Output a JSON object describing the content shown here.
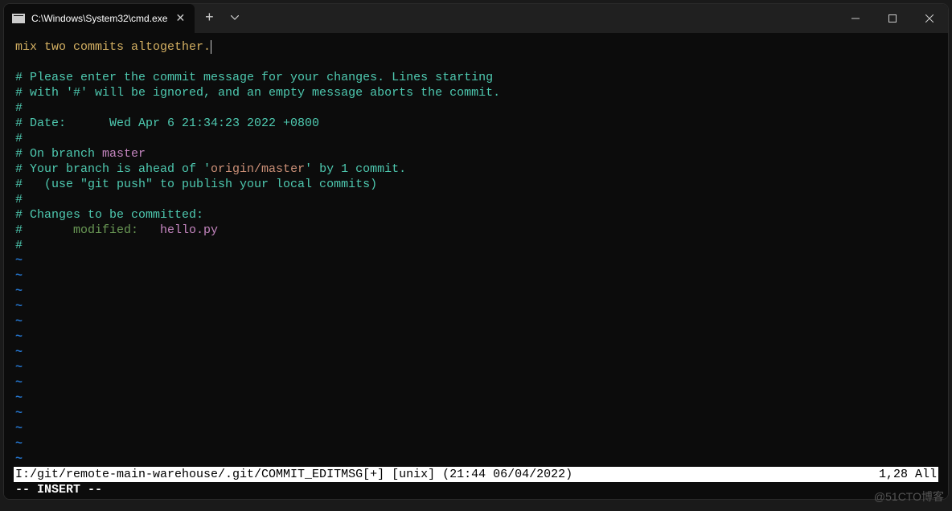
{
  "window": {
    "tab_title": "C:\\Windows\\System32\\cmd.exe"
  },
  "editor": {
    "commit_message": "mix two commits altogether.",
    "comments": {
      "line1": "# Please enter the commit message for your changes. Lines starting",
      "line2": "# with '#' will be ignored, and an empty message aborts the commit.",
      "hash": "#",
      "date": "# Date:      Wed Apr 6 21:34:23 2022 +0800",
      "on_branch_prefix": "# On branch ",
      "branch_name": "master",
      "ahead_prefix": "# Your branch is ahead of '",
      "ahead_remote": "origin/master",
      "ahead_suffix": "' by 1 commit.",
      "push_hint": "#   (use \"git push\" to publish your local commits)",
      "changes_header": "# Changes to be committed:",
      "modified_prefix": "#       ",
      "modified_label": "modified:   ",
      "modified_file": "hello.py"
    },
    "tilde": "~",
    "status": {
      "left": "I:/git/remote-main-warehouse/.git/COMMIT_EDITMSG[+] [unix] (21:44 06/04/2022)",
      "right": "1,28 All"
    },
    "mode": "-- INSERT --"
  },
  "watermark": "@51CTO博客"
}
